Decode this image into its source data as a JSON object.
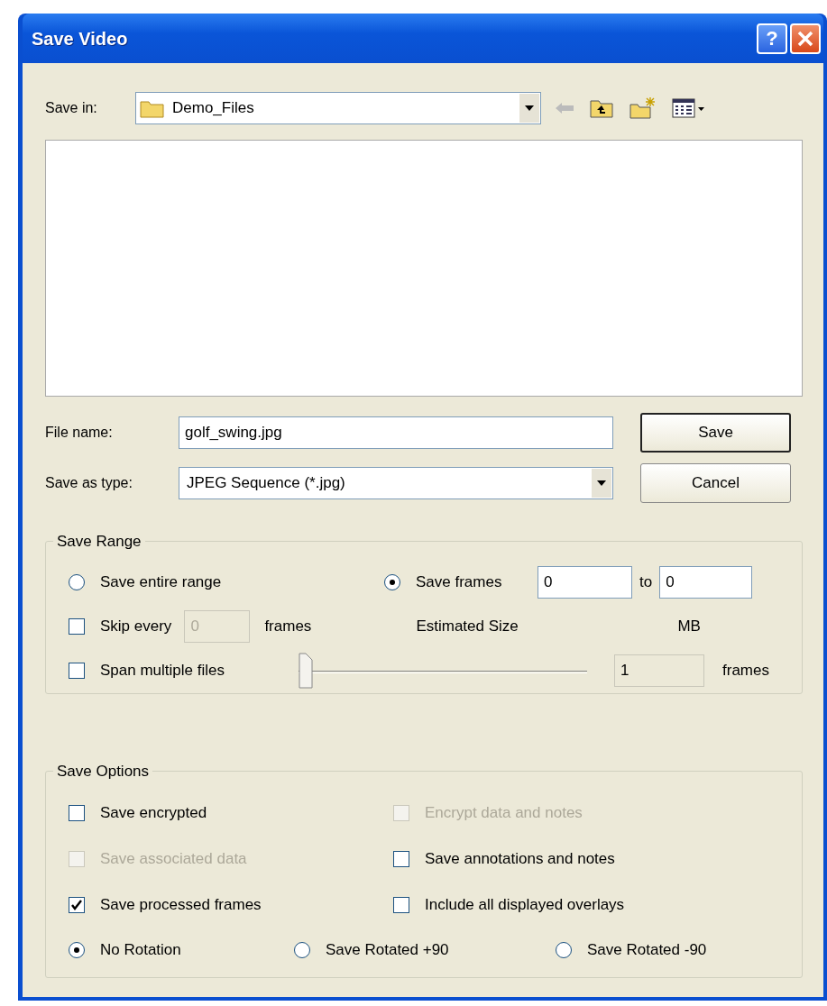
{
  "window": {
    "title": "Save Video",
    "help_label": "?"
  },
  "save_in": {
    "label": "Save in:",
    "folder": "Demo_Files"
  },
  "file_name": {
    "label": "File name:",
    "value": "golf_swing.jpg"
  },
  "save_as_type": {
    "label": "Save as type:",
    "value": "JPEG Sequence (*.jpg)"
  },
  "buttons": [
    {
      "label": "Save",
      "default": true
    },
    {
      "label": "Cancel",
      "default": false
    }
  ],
  "save_range": {
    "title": "Save Range",
    "modes": [
      {
        "label": "Save entire range",
        "selected": false
      },
      {
        "label": "Save frames",
        "selected": true
      }
    ],
    "from_value": "0",
    "to_label": "to",
    "to_value": "0",
    "skip": {
      "label": "Skip every",
      "checked": false,
      "value": "0",
      "unit": "frames"
    },
    "estimated_label": "Estimated Size",
    "estimated_unit": "MB",
    "span": {
      "label": "Span multiple files",
      "checked": false
    },
    "slider": {
      "level": 0
    },
    "files_value": "1",
    "files_unit": "frames"
  },
  "save_options": {
    "title": "Save Options",
    "checkboxes": [
      {
        "label": "Save encrypted",
        "checked": false,
        "disabled": false
      },
      {
        "label": "Encrypt data and notes",
        "checked": false,
        "disabled": true
      },
      {
        "label": "Save associated data",
        "checked": false,
        "disabled": true
      },
      {
        "label": "Save annotations and notes",
        "checked": false,
        "disabled": false
      },
      {
        "label": "Save processed frames",
        "checked": true,
        "disabled": false
      },
      {
        "label": "Include all displayed overlays",
        "checked": false,
        "disabled": false
      }
    ],
    "rotation": [
      {
        "label": "No Rotation",
        "selected": true
      },
      {
        "label": "Save Rotated +90",
        "selected": false
      },
      {
        "label": "Save Rotated -90",
        "selected": false
      }
    ]
  }
}
